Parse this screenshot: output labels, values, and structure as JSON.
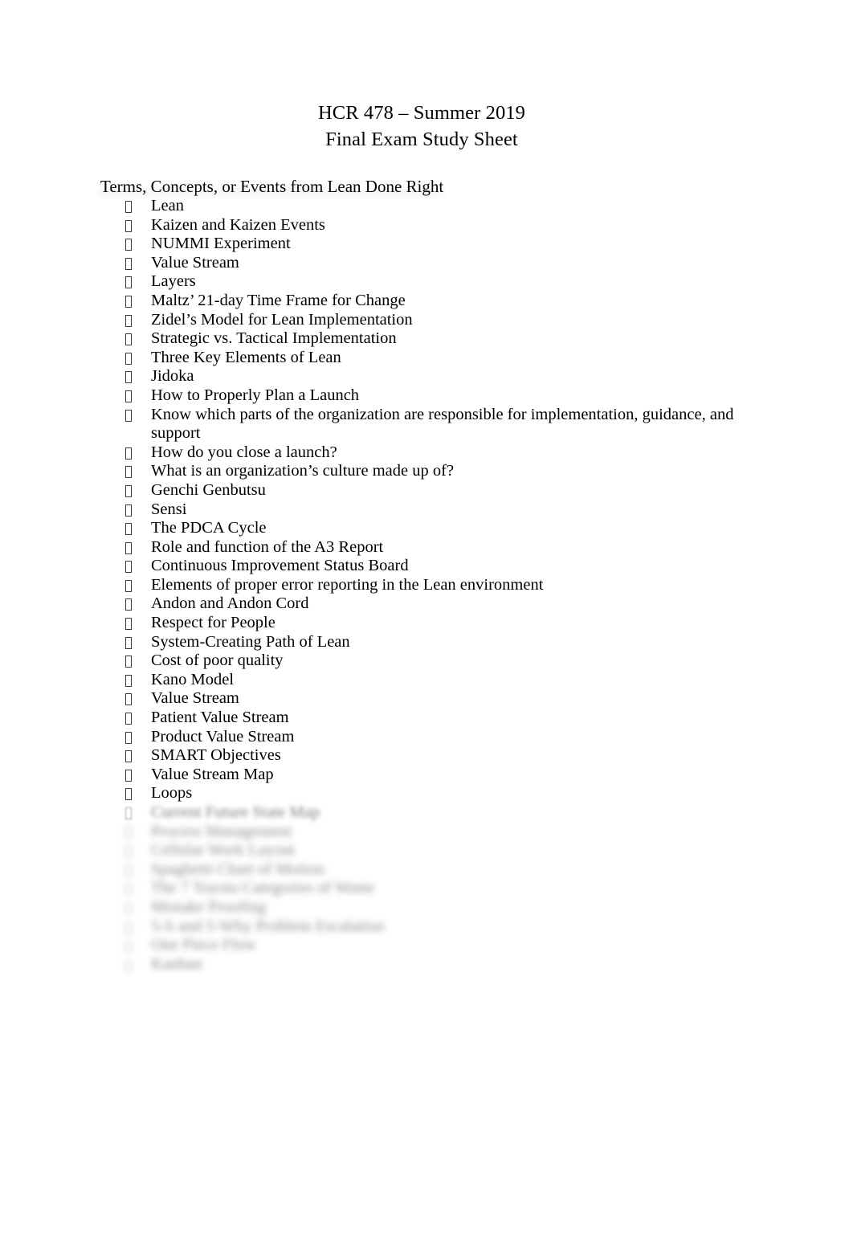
{
  "document": {
    "title_lines": [
      "HCR 478 – Summer 2019",
      "Final Exam Study Sheet"
    ],
    "section_heading": "Terms, Concepts, or Events from Lean Done Right",
    "bullet_glyph": "tofu-box",
    "items": [
      {
        "text": "Lean",
        "legible": true
      },
      {
        "text": "Kaizen and Kaizen Events",
        "legible": true
      },
      {
        "text": "NUMMI Experiment",
        "legible": true
      },
      {
        "text": "Value Stream",
        "legible": true
      },
      {
        "text": "Layers",
        "legible": true
      },
      {
        "text": "Maltz’ 21-day Time Frame for Change",
        "legible": true
      },
      {
        "text": "Zidel’s Model for Lean Implementation",
        "legible": true
      },
      {
        "text": "Strategic vs. Tactical Implementation",
        "legible": true
      },
      {
        "text": "Three Key Elements of Lean",
        "legible": true
      },
      {
        "text": "Jidoka",
        "legible": true
      },
      {
        "text": "How to Properly Plan a Launch",
        "legible": true
      },
      {
        "text": "Know which parts of the organization are responsible for implementation, guidance, and support",
        "legible": true
      },
      {
        "text": "How do you close a launch?",
        "legible": true
      },
      {
        "text": "What is an organization’s culture made up of?",
        "legible": true
      },
      {
        "text": "Genchi Genbutsu",
        "legible": true
      },
      {
        "text": "Sensi",
        "legible": true
      },
      {
        "text": "The PDCA Cycle",
        "legible": true
      },
      {
        "text": "Role and function of the A3 Report",
        "legible": true
      },
      {
        "text": "Continuous Improvement Status Board",
        "legible": true
      },
      {
        "text": "Elements of proper error reporting in the Lean environment",
        "legible": true
      },
      {
        "text": "Andon and Andon Cord",
        "legible": true
      },
      {
        "text": "Respect for People",
        "legible": true
      },
      {
        "text": "System-Creating Path of Lean",
        "legible": true
      },
      {
        "text": "Cost of poor quality",
        "legible": true
      },
      {
        "text": "Kano Model",
        "legible": true
      },
      {
        "text": "Value Stream",
        "legible": true
      },
      {
        "text": "Patient Value Stream",
        "legible": true
      },
      {
        "text": "Product Value Stream",
        "legible": true
      },
      {
        "text": "SMART Objectives",
        "legible": true
      },
      {
        "text": "Value Stream Map",
        "legible": true
      },
      {
        "text": "Loops",
        "legible": true
      },
      {
        "text": "Current Future State Map",
        "legible": false,
        "blur": "soft"
      },
      {
        "text": "Process Management",
        "legible": false,
        "blur": "heavy"
      },
      {
        "text": "Cellular Work Layout",
        "legible": false,
        "blur": "heavy"
      },
      {
        "text": "Spaghetti Chart of Motion",
        "legible": false,
        "blur": "heavy"
      },
      {
        "text": "The 7 Toyota Categories of Waste",
        "legible": false,
        "blur": "heavy"
      },
      {
        "text": "Mistake Proofing",
        "legible": false,
        "blur": "heavy"
      },
      {
        "text": "5-S and 5-Why Problem Escalation",
        "legible": false,
        "blur": "heavy"
      },
      {
        "text": "One Piece Flow",
        "legible": false,
        "blur": "heavy"
      },
      {
        "text": "Kanban",
        "legible": false,
        "blur": "heavy"
      }
    ]
  }
}
